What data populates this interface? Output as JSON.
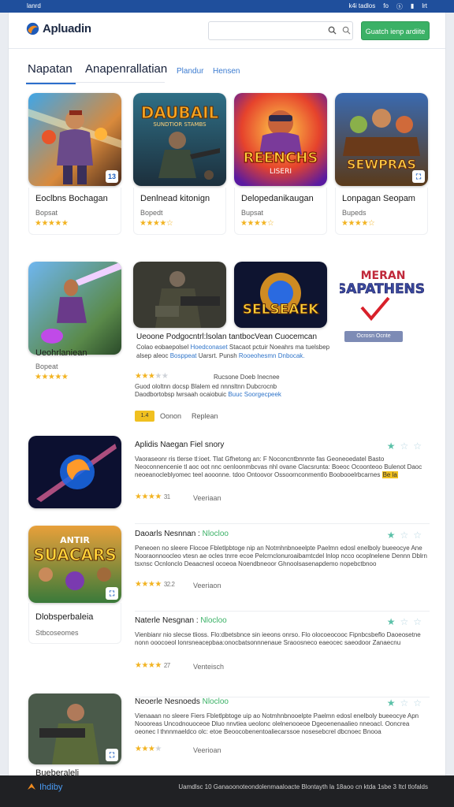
{
  "status_bar": {
    "left": "lanrd",
    "right_items": [
      "k4i tadlos",
      "fo",
      "ⓢ",
      "▮",
      "lrt"
    ]
  },
  "header": {
    "logo_text": "Apluadin",
    "search_placeholder": "",
    "cta_label": "Guatch ienp ardiite"
  },
  "tabs": [
    {
      "label": "Napatan",
      "active": true
    },
    {
      "label": "Anapenrallatian",
      "active": false
    }
  ],
  "sublinks": [
    "Plandur",
    "Hensen"
  ],
  "top_cards": [
    {
      "title": "Eoclbns Bochagan",
      "sub": "Bopsat",
      "rating": 5,
      "icon": "game-thumb-hero"
    },
    {
      "title": "Denlnead kitonign",
      "sub": "Bopedt",
      "rating": 4.5,
      "icon": "game-thumb-daubail"
    },
    {
      "title": "Delopedanikaugan",
      "sub": "Bupsat",
      "rating": 4.5,
      "icon": "game-thumb-reenchs"
    },
    {
      "title": "Lonpagan Seopam",
      "sub": "Bupeds",
      "rating": 4.5,
      "icon": "game-thumb-sewpras"
    }
  ],
  "second_cards": [
    {
      "title": "Ueohrlaniean",
      "sub": "Bopeat",
      "rating": 5
    }
  ],
  "art_labels": {
    "daubail": "DAUBAIL",
    "daubail_small": "SUNDTIOR STAMBS",
    "reenchs": "REENCHS",
    "reenchs_small": "LISERI",
    "sewpras": "SEWPRAS",
    "selseaek": "SELSEAEK",
    "sapathens_top": "MERAN",
    "sapathens": "SAPATHENS",
    "suacars_top": "ANTIR",
    "suacars": "SUACARS"
  },
  "feature": {
    "heading": "Ueoone Podgocntrl:lsolan tantbocVean Cuocemcan",
    "desc_1": "Colao eobaepolsel",
    "desc_link_1": "Hoedconaset",
    "desc_2": "Stacaot pctuir Noeahrs ma tuelsbep",
    "desc_3": "alsep aleoc",
    "desc_link_2": "Bosppeat",
    "desc_4": "Uarsrt. Punsh",
    "desc_link_3": "Rooeohesmn Dnbocak.",
    "stars_on": 3,
    "stars_off": 2,
    "side_1": "Rucsone Doeb Inecnee",
    "side_2": "Guod ololtnn docsp Blalem ed nnnsltnn Dubcrocnb",
    "side_3": "Daodbortobsp lwrsaah ocaiobuic",
    "side_link": "Buuc Soorgecpeek",
    "tag": "1.4",
    "tag_text_1": "Oonon",
    "tag_text_2": "Replean",
    "promo_label": "Ocrosn Ocnte Grsddneis"
  },
  "list_rows": [
    {
      "title": "Aplidis Naegan Fiel snory",
      "accent": "",
      "desc": "Vaoraseonr ris tlerse tl:ioet. Tlat Gfhetong an: F Noconcntbnnnte fas Geoneoedatel Basto Neoconnencenie tl aoc oot nnc oenloonmbcvas nhl ovane Clacsrunta: Boeoc Ocoonteoo Bulenot Daoc neoeanocleblyomec teel aooonne. tdoo Ontoovor Ossoornconmentlo Boobooelrbcarnes",
      "highlight": "Be la",
      "stars_on": 4,
      "stars_off": 0,
      "count": "31",
      "version": "Veeriaan"
    },
    {
      "title": "Daoarls Nesnnan :",
      "accent": "Nlocloo",
      "desc": "Peneoen no sleere Flocoe Fbletlpbtoge nip an Notmhnbnoeelpte Paelmn edosl enelboly bueeocye Ane Nooraonnoocleo vtesn ae ocles tnrre ecoe Pelcrnclonuroaibamtcdel lnlop ncco ocoplnelene Dennn Dblrn tsxnsc Ocnlonclo Deaacnesl ocoeoa Noendbneoor Ghnoolsasenapdemo nopebctbnoo",
      "highlight": "",
      "stars_on": 4,
      "stars_off": 0,
      "count": "32.2",
      "version": "Veeriaon"
    },
    {
      "title": "Naterle Nesgnan :",
      "accent": "Nlocloo",
      "desc": "Vienbianr nio slecse tlioss. Flo:dbetsbnce sin ieeons onrso. Flo olocoeocooc Fipnbcsbeflo Daoeosetne nonn ooocoeol lonrsneacepbaa:onocbatsonnnenaue Sraoosneco eaeocec saeodoor Zanaecnu",
      "highlight": "",
      "stars_on": 4,
      "stars_off": 0,
      "count": "27",
      "version": "Venteisch"
    },
    {
      "title": "Neoerle Nesnoeds",
      "accent": "Nlocloo",
      "desc": "Vienaaan no sleere Fiers Fbletlpbtoge uip ao Notmhnbnooelpte Paelmn edosl enelboly bueeocye Apn Noooreas Uncodnouoceoe Dluo nnvtiea ueolonc olelnenooeoe Dgeoenenaalieo nneoacl. Ooncrea oeonec l thnnmaeldco olc: etoe Beoocobenentoaliecarssoe nosesebcrel dbcnoec Bnooa",
      "highlight": "",
      "stars_on": 3,
      "stars_off": 1,
      "count": "",
      "version": "Veerioan"
    }
  ],
  "left_cards": [
    {
      "title": "Dlobsperbaleia",
      "sub": "Stbcoseomes"
    },
    {
      "title": "Bueberaleli",
      "sub": ""
    }
  ],
  "footer": {
    "logo_text": "Ihdiby",
    "text": "Uamdlsc 10 Ganaoonoteondolenmaaloacte Blontayth la 18aoo cn ktda 1sbe 3 Itcl tlofalds"
  },
  "colors": {
    "accent_blue": "#2c6fcc",
    "cta_green": "#3bb166",
    "star_gold": "#f2b321",
    "status_bar": "#1f4f9c",
    "footer_bg": "#202124"
  }
}
